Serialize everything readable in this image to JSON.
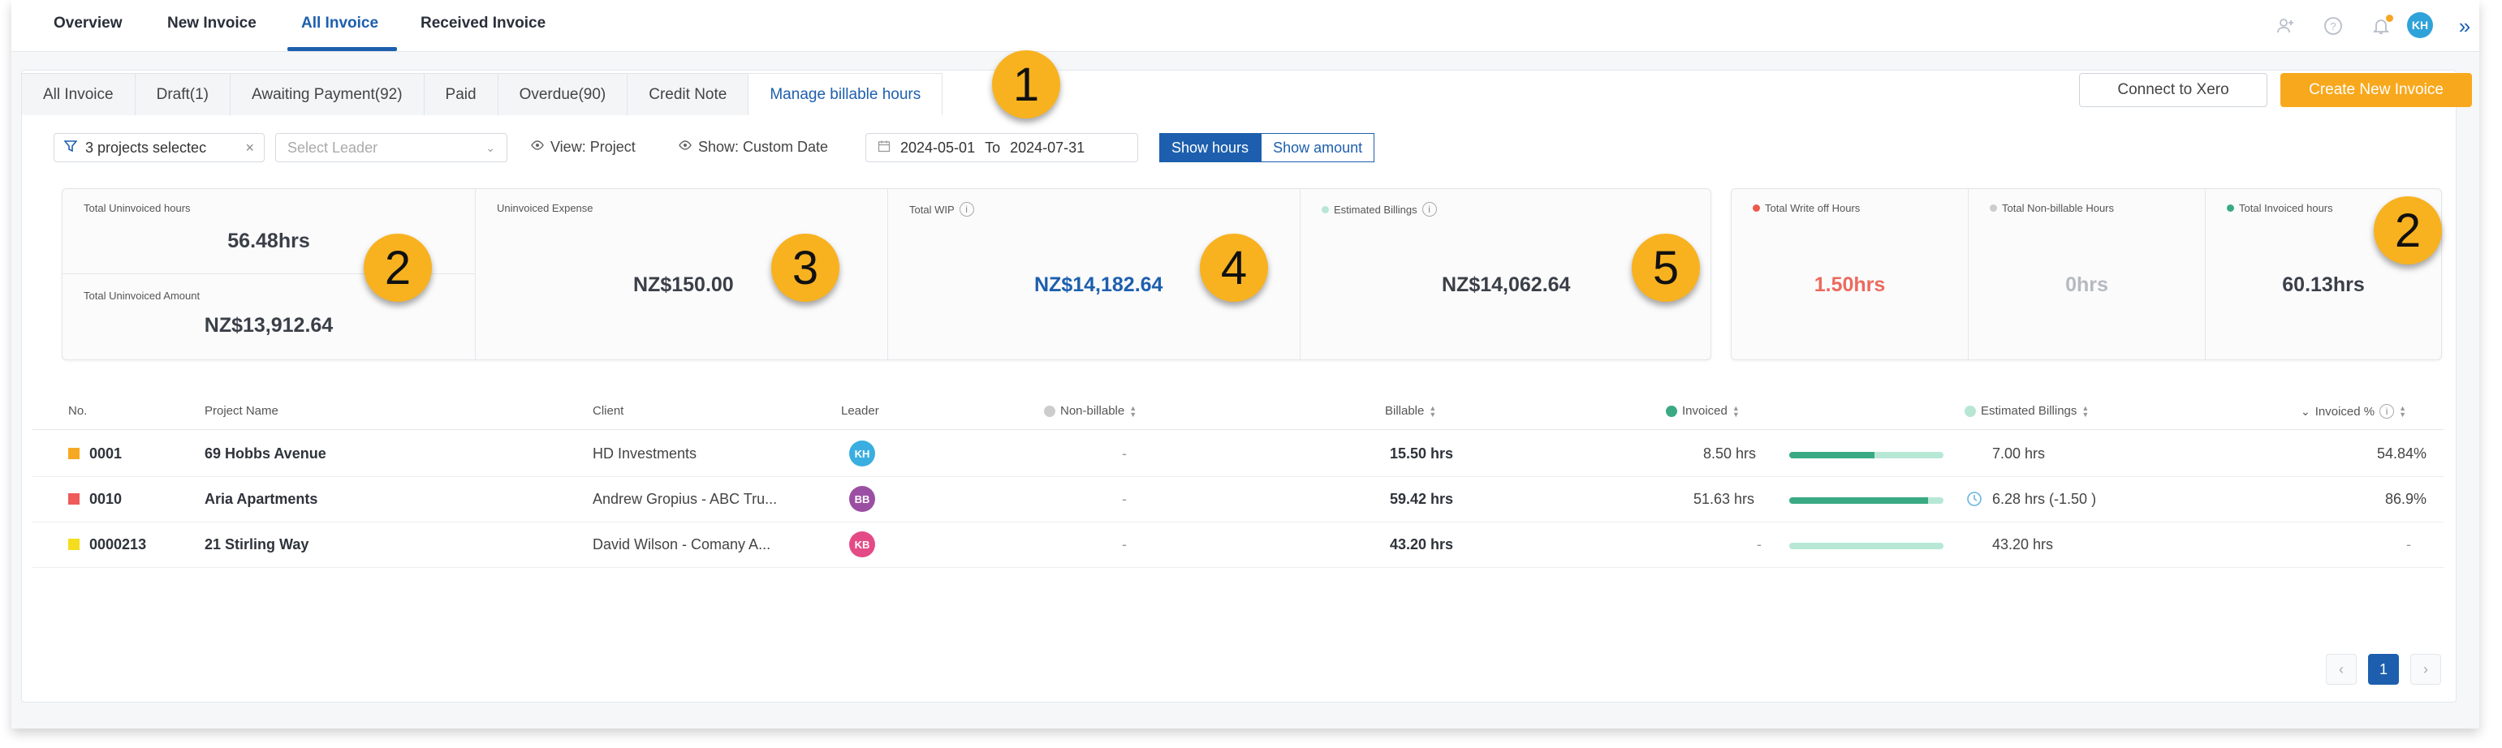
{
  "nav": {
    "tabs": [
      "Overview",
      "New Invoice",
      "All Invoice",
      "Received Invoice"
    ],
    "avatar": "KH"
  },
  "subtabs": [
    "All Invoice",
    "Draft(1)",
    "Awaiting Payment(92)",
    "Paid",
    "Overdue(90)",
    "Credit Note",
    "Manage billable hours"
  ],
  "actions": {
    "connect": "Connect to Xero",
    "create": "Create New Invoice"
  },
  "filters": {
    "projects": "3 projects selectec",
    "leader_placeholder": "Select Leader",
    "view": "View: Project",
    "show": "Show: Custom Date",
    "date_from": "2024-05-01",
    "date_to_label": "To",
    "date_to": "2024-07-31",
    "show_hours": "Show hours",
    "show_amount": "Show amount"
  },
  "summary": {
    "uninvoiced_hours_label": "Total Uninvoiced hours",
    "uninvoiced_hours": "56.48hrs",
    "uninvoiced_amount_label": "Total Uninvoiced Amount",
    "uninvoiced_amount": "NZ$13,912.64",
    "expense_label": "Uninvoiced Expense",
    "expense": "NZ$150.00",
    "wip_label": "Total WIP",
    "wip": "NZ$14,182.64",
    "est_label": "Estimated Billings",
    "est": "NZ$14,062.64",
    "writeoff_label": "Total Write off Hours",
    "writeoff": "1.50hrs",
    "nonbill_label": "Total Non-billable Hours",
    "nonbill": "0hrs",
    "invoiced_label": "Total Invoiced hours",
    "invoiced": "60.13hrs"
  },
  "callouts": [
    "1",
    "2",
    "3",
    "4",
    "5",
    "2"
  ],
  "table": {
    "headers": [
      "No.",
      "Project Name",
      "Client",
      "Leader",
      "Non-billable",
      "Billable",
      "Invoiced",
      "Estimated Billings",
      "Invoiced %"
    ],
    "rows": [
      {
        "no": "0001",
        "name": "69 Hobbs Avenue",
        "client": "HD Investments",
        "leader": "KH",
        "nonbill": "-",
        "billable": "15.50 hrs",
        "invoiced": "8.50 hrs",
        "progress": 0.55,
        "est": "7.00 hrs",
        "pct": "54.84%",
        "color": "#f7a823",
        "leader_color": "#3aaee0"
      },
      {
        "no": "0010",
        "name": "Aria Apartments",
        "client": "Andrew Gropius - ABC Tru...",
        "leader": "BB",
        "nonbill": "-",
        "billable": "59.42 hrs",
        "invoiced": "51.63 hrs",
        "progress": 0.9,
        "est": "6.28 hrs (-1.50 )",
        "pct": "86.9%",
        "color": "#ef5a5a",
        "leader_color": "#9b4fa3"
      },
      {
        "no": "0000213",
        "name": "21 Stirling Way",
        "client": "David Wilson - Comany A...",
        "leader": "KB",
        "nonbill": "-",
        "billable": "43.20 hrs",
        "invoiced": "-",
        "progress": 0,
        "est": "43.20 hrs",
        "pct": "-",
        "color": "#f4dd1c",
        "leader_color": "#e44a86"
      }
    ]
  },
  "pagination": {
    "prev": "‹",
    "current": "1",
    "next": "›"
  }
}
